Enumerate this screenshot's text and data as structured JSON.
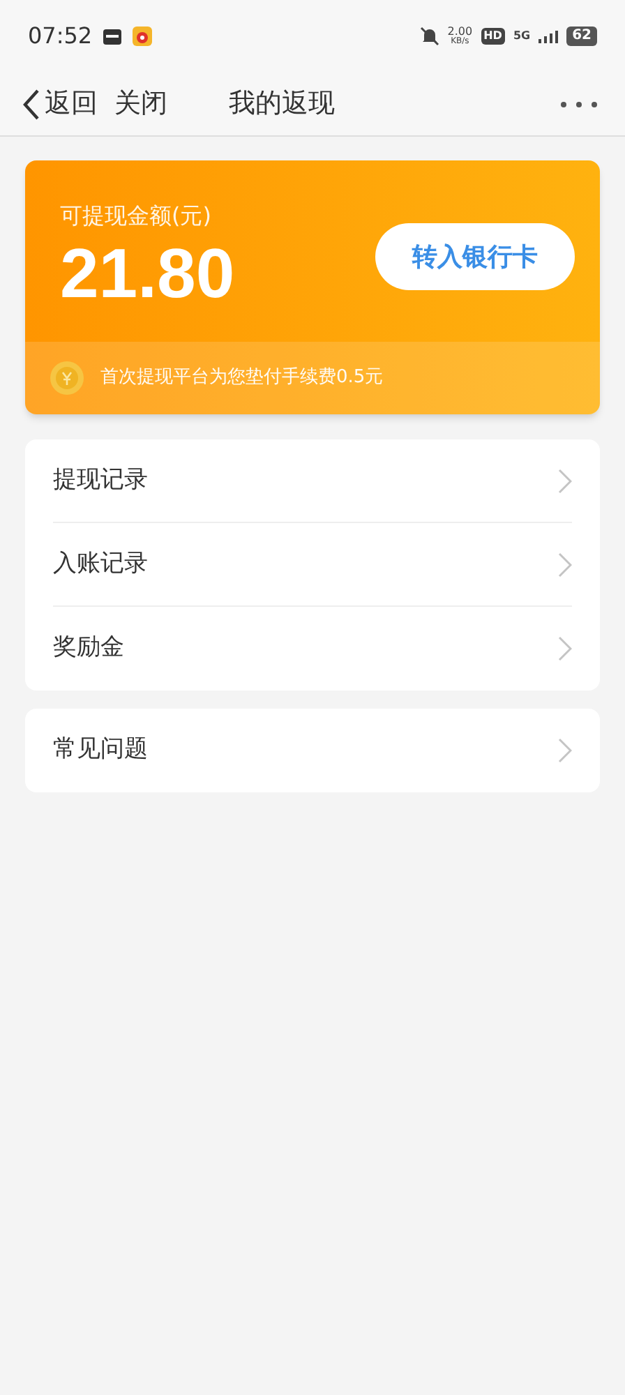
{
  "status_bar": {
    "time": "07:52",
    "speed": "2.00",
    "speed_unit": "KB/s",
    "hd": "HD",
    "network": "5G",
    "battery": "62"
  },
  "nav": {
    "back": "返回",
    "close": "关闭",
    "title": "我的返现"
  },
  "balance": {
    "label": "可提现金额(元)",
    "amount": "21.80",
    "button": "转入银行卡",
    "notice": "首次提现平台为您垫付手续费0.5元"
  },
  "menu_groups": [
    [
      {
        "label": "提现记录"
      },
      {
        "label": "入账记录"
      },
      {
        "label": "奖励金"
      }
    ],
    [
      {
        "label": "常见问题"
      }
    ]
  ]
}
